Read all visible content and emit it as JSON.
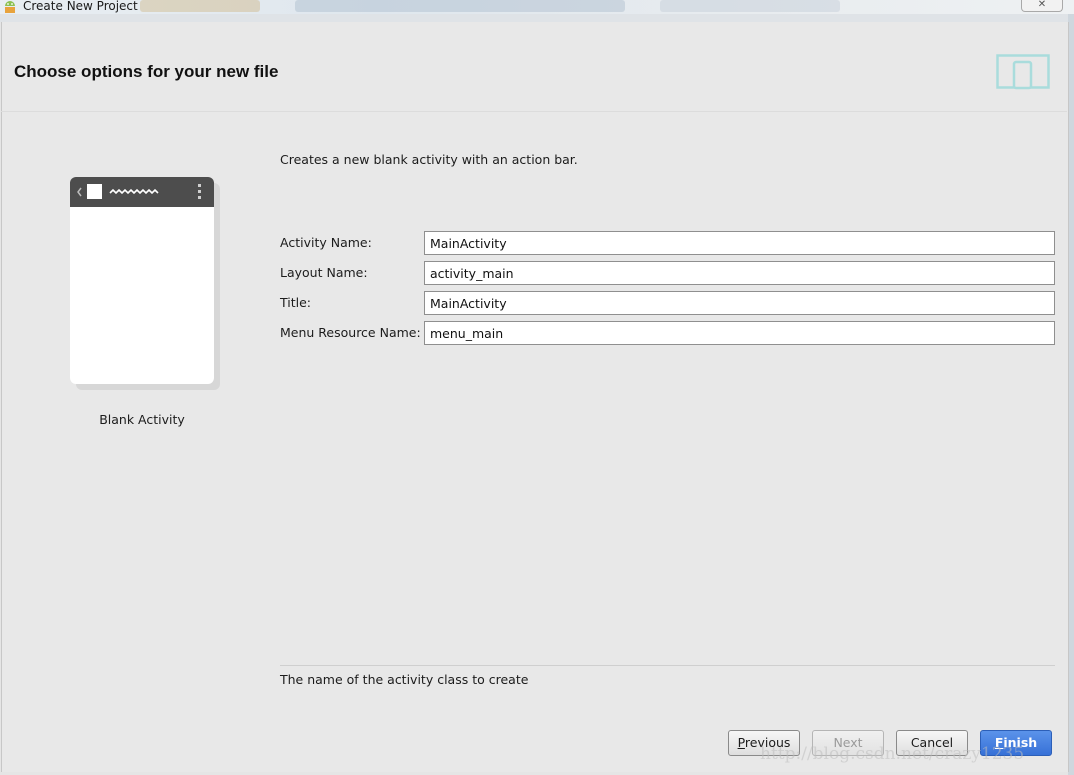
{
  "window": {
    "title": "Create New Project",
    "close_label": "✕"
  },
  "header": {
    "title": "Choose options for your new file"
  },
  "preview": {
    "caption": "Blank Activity"
  },
  "description": "Creates a new blank activity with an action bar.",
  "form": {
    "fields": [
      {
        "label": "Activity Name:",
        "value": "MainActivity"
      },
      {
        "label": "Layout Name:",
        "value": "activity_main"
      },
      {
        "label": "Title:",
        "value": "MainActivity"
      },
      {
        "label": "Menu Resource Name:",
        "value": "menu_main"
      }
    ]
  },
  "hint": "The name of the activity class to create",
  "buttons": {
    "previous": "Previous",
    "next": "Next",
    "cancel": "Cancel",
    "finish": "Finish"
  },
  "watermark": "http://blog.csdn.net/crazy1235",
  "colors": {
    "primary_button": "#3771d7",
    "phone_bar": "#4d4d4d",
    "logo": "#a9dcdc"
  },
  "icons": {
    "app": "android-studio-icon",
    "header_logo": "device-tablet-phone-icon",
    "back": "chevron-left-icon",
    "overflow": "overflow-menu-icon"
  }
}
